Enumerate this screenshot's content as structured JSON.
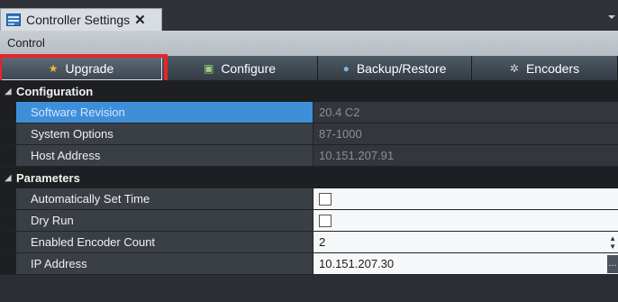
{
  "tab": {
    "title": "Controller Settings",
    "close": "✕"
  },
  "group": {
    "title": "Control"
  },
  "buttons": [
    {
      "label": "Upgrade",
      "icon": "star-icon",
      "glyph": "★"
    },
    {
      "label": "Configure",
      "icon": "document-icon",
      "glyph": "▣"
    },
    {
      "label": "Backup/Restore",
      "icon": "disc-icon",
      "glyph": "●"
    },
    {
      "label": "Encoders",
      "icon": "gear-icon",
      "glyph": "✲"
    }
  ],
  "categories": {
    "configuration": "Configuration",
    "parameters": "Parameters"
  },
  "configuration": [
    {
      "name": "Software Revision",
      "value": "20.4 C2"
    },
    {
      "name": "System Options",
      "value": "87-1000"
    },
    {
      "name": "Host Address",
      "value": "10.151.207.91"
    }
  ],
  "parameters": [
    {
      "name": "Automatically Set Time"
    },
    {
      "name": "Dry Run"
    },
    {
      "name": "Enabled Encoder Count",
      "value": "2"
    },
    {
      "name": "IP Address",
      "value": "10.151.207.30"
    }
  ],
  "colors": {
    "highlight": "#e3262a",
    "selection": "#3f8fd8"
  }
}
